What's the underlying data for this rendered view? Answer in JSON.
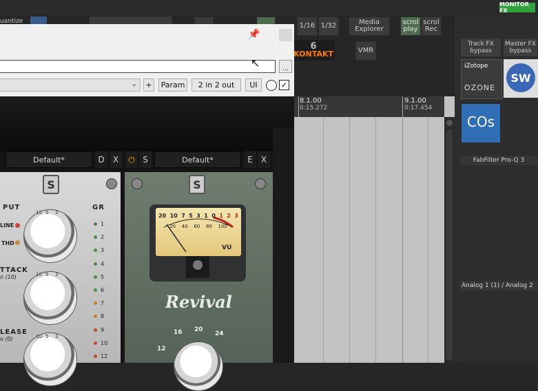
{
  "top_bar": {
    "left_label": "uantize",
    "monitor_fx": "MONITOR FX",
    "grid_buttons": [
      "1/16",
      "1/32"
    ],
    "media_explorer": "Media\nExplorer",
    "scroll_play": "scrol\nplay",
    "scroll_rec": "scrol\nRec",
    "vmr": "VMR",
    "kontakt_label": "KONTAKT",
    "kontakt_value": "6"
  },
  "right_panel": {
    "track_fx_bypass": "Track FX\nbypass",
    "master_fx_bypass": "Master FX\nbypass",
    "izotope_label": "iZotope",
    "ozone_label": "OZONE",
    "sw_label": "SW",
    "cos_label": "COs",
    "fabfilter": "FabFilter Pro-Q 3",
    "analog_io": "Analog 1 (1) / Analog 2"
  },
  "timeline": {
    "markers": [
      {
        "bar": "8.1.00",
        "time": "0:15.272"
      },
      {
        "bar": "9.1.00",
        "time": "0:17.454"
      }
    ]
  },
  "plugin_window": {
    "path_browse": "...",
    "param_button": "Param",
    "io_button": "2 in 2 out",
    "ui_button": "UI",
    "add_button": "+",
    "enabled_checkbox": true,
    "left_unit": {
      "preset": "Default*",
      "btn_d": "D",
      "btn_x": "X",
      "input_label": "PUT",
      "attack_label": "TTACK",
      "attack_sub": "o (10)",
      "release_label": "LEASE",
      "release_sub": "o (0)",
      "gr_label": "GR",
      "line_label": "LINE",
      "thd_label": "THD",
      "gr_scale": [
        "1",
        "2",
        "3",
        "4",
        "5",
        "6",
        "7",
        "8",
        "9",
        "10",
        "12"
      ],
      "knob_numbers": [
        "10",
        "5",
        "3",
        "7",
        "9",
        "1",
        "4",
        "2",
        "8"
      ]
    },
    "revival_unit": {
      "preset": "Default*",
      "btn_s": "S",
      "btn_e": "E",
      "btn_x": "X",
      "vu_label": "VU",
      "vu_scale": [
        "20",
        "10",
        "7",
        "5",
        "3",
        "1",
        "0",
        "1",
        "2",
        "3"
      ],
      "vu_lower_scale": [
        "20",
        "40",
        "60",
        "80",
        "100"
      ],
      "title": "Revival",
      "dial_numbers": [
        "16",
        "20",
        "24",
        "12"
      ]
    }
  }
}
